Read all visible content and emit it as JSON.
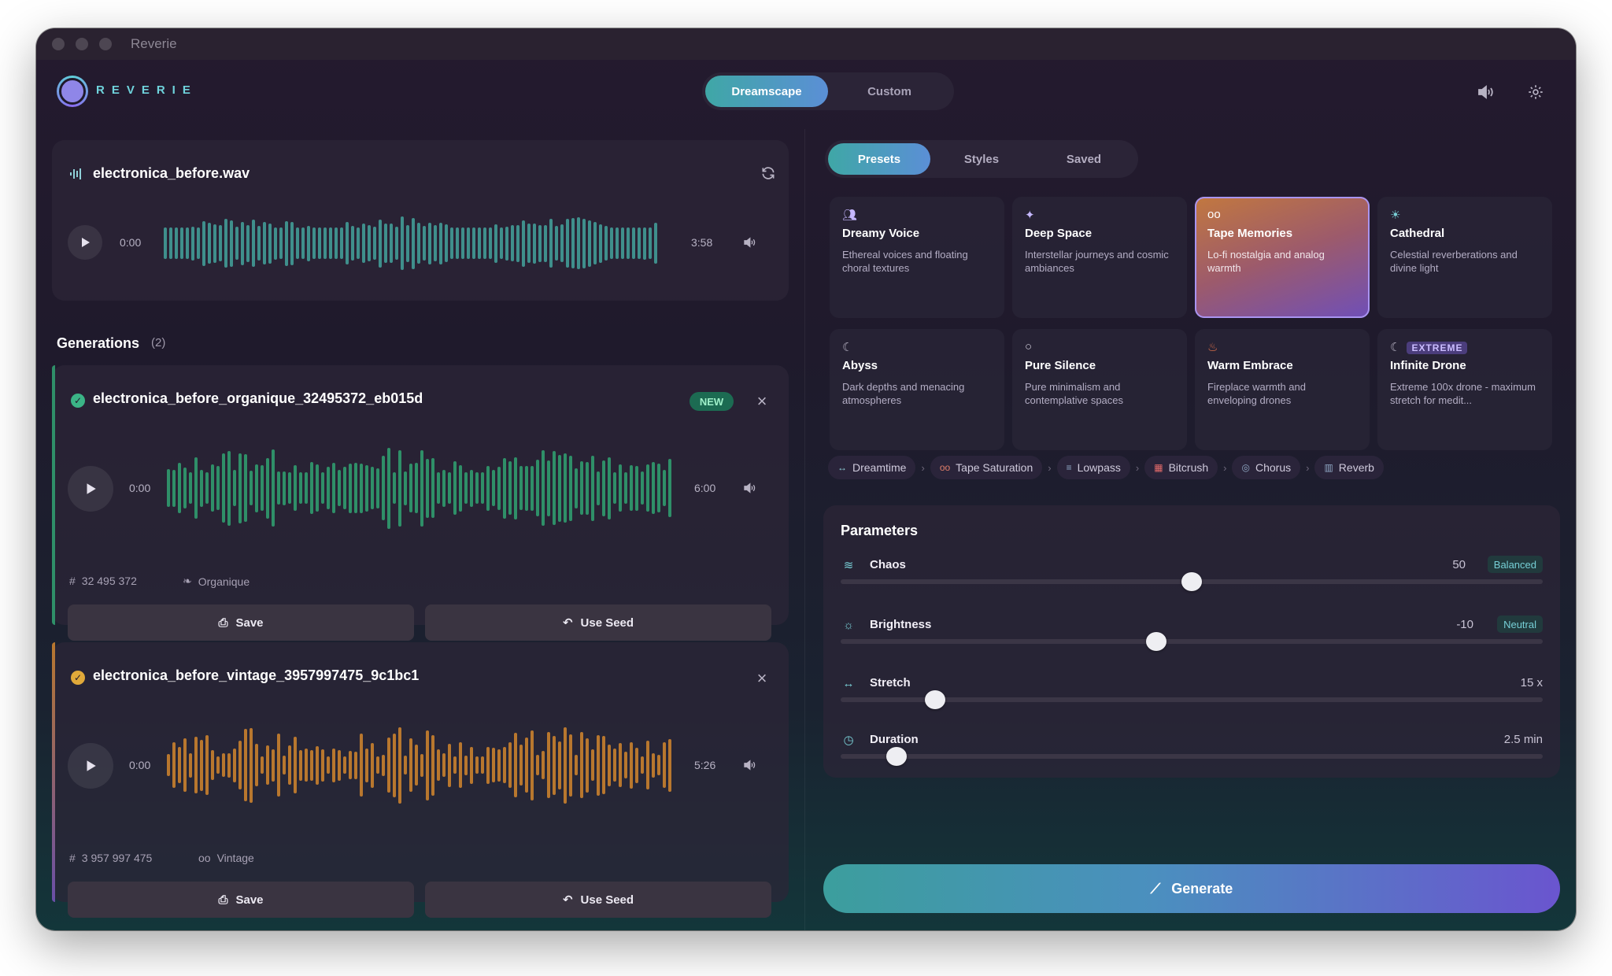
{
  "window": {
    "title": "Reverie"
  },
  "brand": {
    "name": "REVERIE"
  },
  "modes": [
    {
      "label": "Dreamscape",
      "active": true
    },
    {
      "label": "Custom",
      "active": false
    }
  ],
  "source": {
    "filename": "electronica_before.wav",
    "current_time": "0:00",
    "duration": "3:58"
  },
  "generations": {
    "heading": "Generations",
    "count": "(2)",
    "items": [
      {
        "name": "electronica_before_organique_32495372_eb015d",
        "badge": "NEW",
        "current_time": "0:00",
        "duration": "6:00",
        "seed": "32 495 372",
        "style": "Organique",
        "save_label": "Save",
        "use_seed_label": "Use Seed",
        "color": "#2f8f68"
      },
      {
        "name": "electronica_before_vintage_3957997475_9c1bc1",
        "current_time": "0:00",
        "duration": "5:26",
        "seed": "3 957 997 475",
        "style": "Vintage",
        "save_label": "Save",
        "use_seed_label": "Use Seed",
        "color": "#b8772e"
      }
    ]
  },
  "tabs": [
    {
      "label": "Presets",
      "active": true
    },
    {
      "label": "Styles",
      "active": false
    },
    {
      "label": "Saved",
      "active": false
    }
  ],
  "presets": [
    {
      "name": "Dreamy Voice",
      "desc": "Ethereal voices and floating choral textures",
      "icon": "people-icon"
    },
    {
      "name": "Deep Space",
      "desc": "Interstellar journeys and cosmic ambiances",
      "icon": "sparkle-icon"
    },
    {
      "name": "Tape Memories",
      "desc": "Lo-fi nostalgia and analog warmth",
      "icon": "cassette-icon",
      "selected": true
    },
    {
      "name": "Cathedral",
      "desc": "Celestial reverberations and divine light",
      "icon": "sun-icon"
    },
    {
      "name": "Abyss",
      "desc": "Dark depths and menacing atmospheres",
      "icon": "moon-icon"
    },
    {
      "name": "Pure Silence",
      "desc": "Pure minimalism and contemplative spaces",
      "icon": "circle-icon"
    },
    {
      "name": "Warm Embrace",
      "desc": "Fireplace warmth and enveloping drones",
      "icon": "flame-icon"
    },
    {
      "name": "Infinite Drone",
      "desc": "Extreme 100x drone - maximum stretch for medit...",
      "icon": "moon-icon",
      "badge": "EXTREME"
    }
  ],
  "chain": [
    {
      "label": "Dreamtime",
      "icon": "↔"
    },
    {
      "label": "Tape Saturation",
      "icon": "oo"
    },
    {
      "label": "Lowpass",
      "icon": "≡"
    },
    {
      "label": "Bitcrush",
      "icon": "▦"
    },
    {
      "label": "Chorus",
      "icon": "◎"
    },
    {
      "label": "Reverb",
      "icon": "▥"
    }
  ],
  "parameters": {
    "title": "Parameters",
    "items": [
      {
        "label": "Chaos",
        "value": "50",
        "tag": "Balanced",
        "fraction": 0.5
      },
      {
        "label": "Brightness",
        "value": "-10",
        "tag": "Neutral",
        "fraction": 0.45
      },
      {
        "label": "Stretch",
        "value": "15 x",
        "fraction": 0.135
      },
      {
        "label": "Duration",
        "value": "2.5 min",
        "fraction": 0.08
      }
    ]
  },
  "generate": {
    "label": "Generate"
  }
}
